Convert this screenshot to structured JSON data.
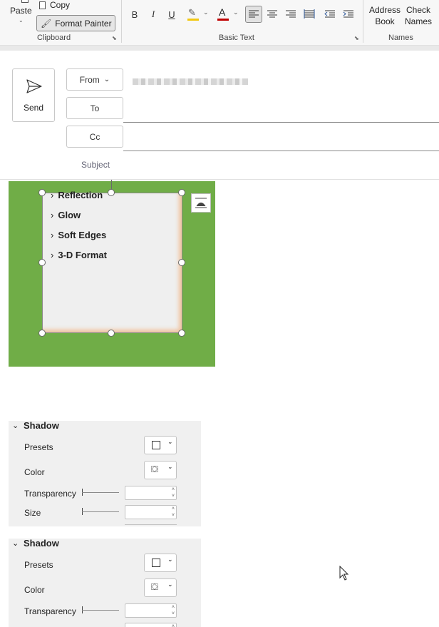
{
  "ribbon": {
    "paste_label": "Paste",
    "copy_label": "Copy",
    "format_painter_label": "Format Painter",
    "clipboard_group": "Clipboard",
    "basic_text_group": "Basic Text",
    "names_group": "Names",
    "address_book_line1": "Address",
    "address_book_line2": "Book",
    "check_names_line1": "Check",
    "check_names_line2": "Names",
    "bold": "B",
    "italic": "I",
    "underline": "U",
    "font_color_glyph": "A",
    "highlight_color": "#f2c811",
    "font_color": "#c00000"
  },
  "compose": {
    "send_label": "Send",
    "from_label": "From",
    "to_label": "To",
    "cc_label": "Cc",
    "subject_label": "Subject"
  },
  "canvas": {
    "background_color": "#70ad47",
    "menu_items": [
      "Reflection",
      "Glow",
      "Soft Edges",
      "3-D Format"
    ]
  },
  "panels": [
    {
      "title": "Shadow",
      "presets_label": "Presets",
      "color_label": "Color",
      "transparency_label": "Transparency",
      "size_label": "Size"
    },
    {
      "title": "Shadow",
      "presets_label": "Presets",
      "color_label": "Color",
      "transparency_label": "Transparency"
    }
  ]
}
